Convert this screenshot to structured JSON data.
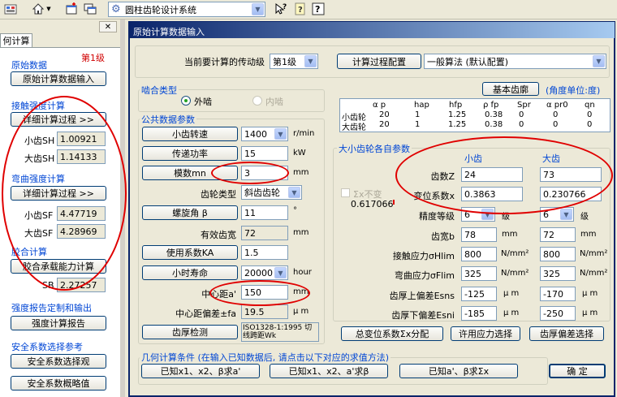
{
  "toolbar": {
    "module_select": "圆柱齿轮设计系统",
    "icons": [
      "settings-icon",
      "home-icon",
      "window-icon",
      "window-list-icon",
      "whatsthis-icon",
      "notes-icon",
      "help-icon"
    ]
  },
  "sidebar": {
    "tab_label": "何计算",
    "stage": "第1级",
    "section_original": "原始数据",
    "btn_original": "原始计算数据输入",
    "section_contact": "接触强度计算",
    "btn_contact_detail": "详细计算过程  >>",
    "sh_small_label": "小齿SH",
    "sh_small": "1.00921",
    "sh_large_label": "大齿SH",
    "sh_large": "1.14133",
    "section_bending": "弯曲强度计算",
    "btn_bending_detail": "详细计算过程  >>",
    "sf_small_label": "小齿SF",
    "sf_small": "4.47719",
    "sf_large_label": "大齿SF",
    "sf_large": "4.28969",
    "section_glue": "胶合计算",
    "btn_glue": "胶合承载能力计算",
    "sb_label": "SB",
    "sb": "2.27257",
    "section_report": "强度报告定制和输出",
    "btn_report": "强度计算报告",
    "section_safety": "安全系数选择参考",
    "btn_safety_select": "安全系数选择观",
    "btn_safety_brief": "安全系数概略值"
  },
  "panel": {
    "title": "原始计算数据输入",
    "stage_label": "当前要计算的传动级",
    "stage_value": "第1级",
    "btn_config": "计算过程配置",
    "method_value": "一般算法 (默认配置)",
    "btn_rack": "基本齿廓",
    "angle_unit": "(角度单位:度)",
    "mesh_group": "啮合类型",
    "mesh_external": "外啮",
    "mesh_internal": "内啮",
    "rack_table": {
      "headers": [
        "α p",
        "hap",
        "hfp",
        "ρ fp",
        "Spr",
        "α pr0",
        "qn"
      ],
      "rows": [
        {
          "name": "小齿轮",
          "values": [
            "20",
            "1",
            "1.25",
            "0.38",
            "0",
            "0",
            "0"
          ]
        },
        {
          "name": "大齿轮",
          "values": [
            "20",
            "1",
            "1.25",
            "0.38",
            "0",
            "0",
            "0"
          ]
        }
      ]
    },
    "common_group": "公共数据参数",
    "speed_btn": "小齿转速",
    "speed_value": "1400",
    "speed_unit": "r/min",
    "power_btn": "传递功率",
    "power_value": "15",
    "power_unit": "kW",
    "module_btn": "模数mn",
    "module_value": "3",
    "module_unit": "mm",
    "gear_type_label": "齿轮类型",
    "gear_type_value": "斜齿齿轮",
    "helix_btn": "螺旋角 β",
    "helix_value": "11",
    "helix_unit": "°",
    "face_eff_label": "有效齿宽",
    "face_eff_value": "72",
    "face_eff_unit": "mm",
    "ka_btn": "使用系数KA",
    "ka_value": "1.5",
    "hours_btn": "小时寿命",
    "hours_value": "20000",
    "hours_unit": "hour",
    "center_label": "中心距a'",
    "center_value": "150",
    "center_unit": "mm",
    "center_tol_label": "中心距偏差±fa",
    "center_tol_value": "19.5",
    "center_tol_unit": "μ m",
    "tooth_check_btn": "齿厚检测",
    "tooth_check_value": "ISO1328-1:1995 切线跨距Wk",
    "each_group": "大小齿轮各自参数",
    "col_small": "小齿",
    "col_large": "大齿",
    "sum_checkbox": "Σx不变",
    "sum_value": "0.617066",
    "teeth_label": "齿数Z",
    "teeth_small": "24",
    "teeth_large": "73",
    "shift_label": "变位系数x",
    "shift_small": "0.3863",
    "shift_large": "0.230766",
    "grade_label": "精度等级",
    "grade_small": "6",
    "grade_large": "6",
    "grade_unit": "级",
    "width_label": "齿宽b",
    "width_small": "78",
    "width_large": "72",
    "width_unit": "mm",
    "contact_label": "接触应力σHlim",
    "contact_small": "800",
    "contact_large": "800",
    "stress_unit": "N/mm²",
    "bending_label": "弯曲应力σFlim",
    "bending_small": "325",
    "bending_large": "325",
    "upper_label": "齿厚上偏差Esns",
    "upper_small": "-125",
    "upper_large": "-170",
    "micron_unit": "μ m",
    "lower_label": "齿厚下偏差Esni",
    "lower_small": "-185",
    "lower_large": "-250",
    "btn_shift_dist": "总变位系数Σx分配",
    "btn_stress": "许用应力选择",
    "btn_tooth_dev": "齿厚偏差选择",
    "geo_group": "几何计算条件 (在输入已知数据后, 请点击以下对应的求值方法)",
    "btn_geo1": "已知x1、x2、β求a'",
    "btn_geo2": "已知x1、x2、a'求β",
    "btn_geo3": "已知a'、β求Σx",
    "btn_ok": "确  定"
  },
  "colors": {
    "accent_blue": "#0046d5",
    "title_grad_start": "#0a246a",
    "title_grad_end": "#a6caf0",
    "annotation_red": "#e00000",
    "stage_red": "#d00000"
  }
}
